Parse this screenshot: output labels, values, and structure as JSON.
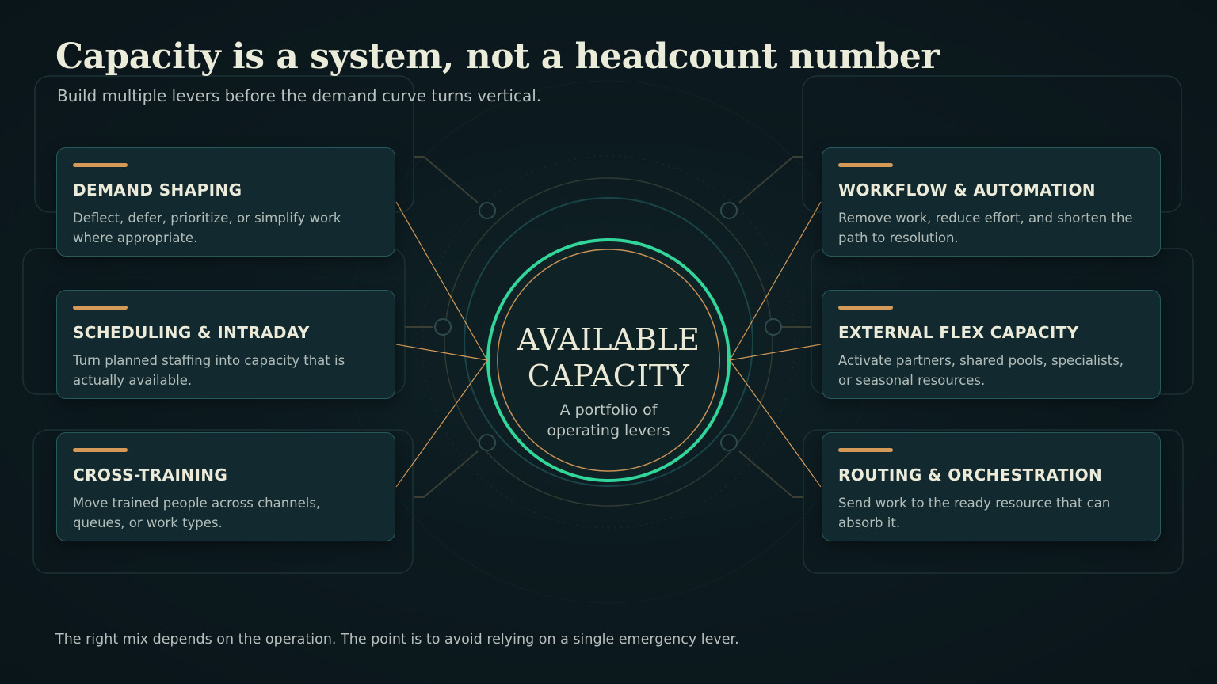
{
  "header": {
    "title": "Capacity is a system, not a headcount number",
    "subtitle": "Build multiple levers before the demand curve turns vertical."
  },
  "hub": {
    "title": "AVAILABLE CAPACITY",
    "subtitle": "A portfolio of operating levers"
  },
  "levers": [
    {
      "title": "DEMAND SHAPING",
      "description": "Deflect, defer, prioritize, or simplify work where appropriate."
    },
    {
      "title": "SCHEDULING & INTRADAY",
      "description": "Turn planned staffing into capacity that is actually available."
    },
    {
      "title": "CROSS-TRAINING",
      "description": "Move trained people across channels, queues, or work types."
    },
    {
      "title": "WORKFLOW & AUTOMATION",
      "description": "Remove work, reduce effort, and shorten the path to resolution."
    },
    {
      "title": "EXTERNAL FLEX CAPACITY",
      "description": "Activate partners, shared pools, specialists, or seasonal resources."
    },
    {
      "title": "ROUTING & ORCHESTRATION",
      "description": "Send work to the ready resource that can absorb it."
    }
  ],
  "footer": {
    "note": "The right mix depends on the operation. The point is to avoid relying on a single emergency lever."
  },
  "colors": {
    "accent": "#d69a58",
    "hub_ring": "#33d69a",
    "card_fill": "#122a2f",
    "card_border": "#285a5c"
  }
}
